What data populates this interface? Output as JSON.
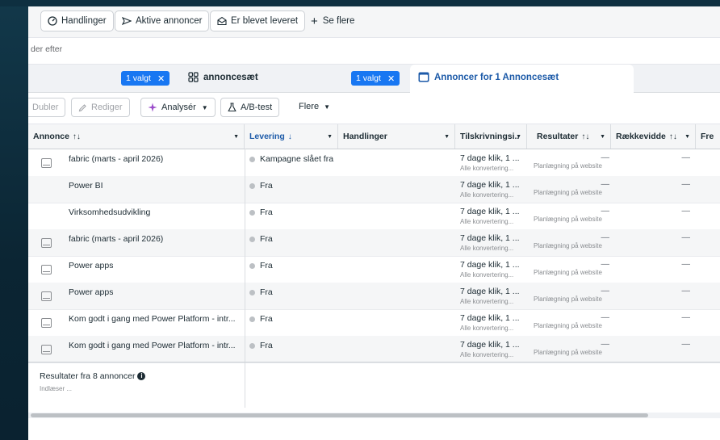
{
  "topbar": {
    "buttons": [
      {
        "label": "Handlinger",
        "icon": "gauge-icon"
      },
      {
        "label": "Aktive annoncer",
        "icon": "send-icon"
      },
      {
        "label": "Er blevet leveret",
        "icon": "envelope-open-icon"
      }
    ],
    "more_label": "Se flere"
  },
  "filter": {
    "text": "der efter"
  },
  "tabs": {
    "campaign_badge": "1 valgt",
    "adset_label": "annoncesæt",
    "adset_badge": "1 valgt",
    "ads_label": "Annoncer for 1 Annoncesæt"
  },
  "toolbar": {
    "duplicate": "Dubler",
    "edit": "Rediger",
    "analyze": "Analysér",
    "abtest": "A/B-test",
    "more": "Flere"
  },
  "table": {
    "columns": [
      {
        "label": "Annonce",
        "sort": "↑↓"
      },
      {
        "label": "Levering",
        "sort": "↓"
      },
      {
        "label": "Handlinger",
        "sort": ""
      },
      {
        "label": "Tilskrivningsi..",
        "sort": ""
      },
      {
        "label": "Resultater",
        "sort": "↑↓"
      },
      {
        "label": "Rækkevidde",
        "sort": "↑↓"
      },
      {
        "label": "Fre",
        "sort": ""
      }
    ],
    "rows": [
      {
        "name": "fabric (marts - april 2026)",
        "has_icon": true,
        "delivery": "Kampagne slået fra",
        "attr": "7 dage klik, 1 ...",
        "attr_sub": "Alle konvertering...",
        "result": "—",
        "result_sub": "Planlægning på website",
        "reach": "—"
      },
      {
        "name": "Power BI",
        "has_icon": false,
        "delivery": "Fra",
        "attr": "7 dage klik, 1 ...",
        "attr_sub": "Alle konvertering...",
        "result": "—",
        "result_sub": "Planlægning på website",
        "reach": "—"
      },
      {
        "name": "Virksomhedsudvikling",
        "has_icon": false,
        "delivery": "Fra",
        "attr": "7 dage klik, 1 ...",
        "attr_sub": "Alle konvertering...",
        "result": "—",
        "result_sub": "Planlægning på website",
        "reach": "—"
      },
      {
        "name": "fabric (marts - april 2026)",
        "has_icon": true,
        "delivery": "Fra",
        "attr": "7 dage klik, 1 ...",
        "attr_sub": "Alle konvertering...",
        "result": "—",
        "result_sub": "Planlægning på website",
        "reach": "—"
      },
      {
        "name": "Power apps",
        "has_icon": true,
        "delivery": "Fra",
        "attr": "7 dage klik, 1 ...",
        "attr_sub": "Alle konvertering...",
        "result": "—",
        "result_sub": "Planlægning på website",
        "reach": "—"
      },
      {
        "name": "Power apps",
        "has_icon": true,
        "delivery": "Fra",
        "attr": "7 dage klik, 1 ...",
        "attr_sub": "Alle konvertering...",
        "result": "—",
        "result_sub": "Planlægning på website",
        "reach": "—"
      },
      {
        "name": "Kom godt i gang med Power Platform - intr...",
        "has_icon": true,
        "delivery": "Fra",
        "attr": "7 dage klik, 1 ...",
        "attr_sub": "Alle konvertering...",
        "result": "—",
        "result_sub": "Planlægning på website",
        "reach": "—"
      },
      {
        "name": "Kom godt i gang med Power Platform - intr...",
        "has_icon": true,
        "delivery": "Fra",
        "attr": "7 dage klik, 1 ...",
        "attr_sub": "Alle konvertering...",
        "result": "—",
        "result_sub": "Planlægning på website",
        "reach": "—"
      }
    ]
  },
  "summary": {
    "title": "Resultater fra 8 annoncer",
    "info_icon": "i",
    "loading": "Indlæser ..."
  },
  "colors": {
    "accent": "#1877f2",
    "link": "#1c5aa8",
    "bg": "#0c2a3a"
  }
}
